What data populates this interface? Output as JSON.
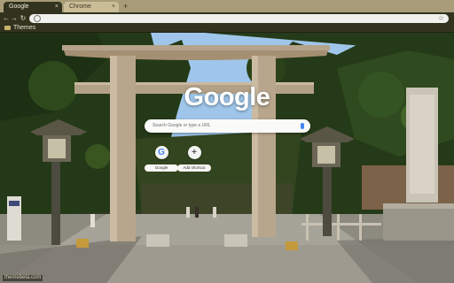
{
  "tabs": [
    {
      "label": "Google"
    },
    {
      "label": "Chrome"
    }
  ],
  "toolbar": {
    "omnibox_placeholder": ""
  },
  "bookmarks": [
    {
      "label": "Themes"
    }
  ],
  "ntp": {
    "logo_text": "Google",
    "search_placeholder": "Search Google or type a URL",
    "shortcuts": [
      {
        "label": "Google",
        "glyph": "G",
        "icon": "google-g-icon"
      },
      {
        "label": "Add shortcut",
        "glyph": "+",
        "icon": "plus-icon"
      }
    ],
    "credit": "themebeta.com"
  },
  "colors": {
    "frame": "#a89c79",
    "toolbar": "#32331f",
    "active_tab": "#32331f",
    "inactive_tab": "#c9bd97",
    "torii_wood": "#b5a38a",
    "sky": "#9fc6ea",
    "foliage": "#263b19"
  }
}
